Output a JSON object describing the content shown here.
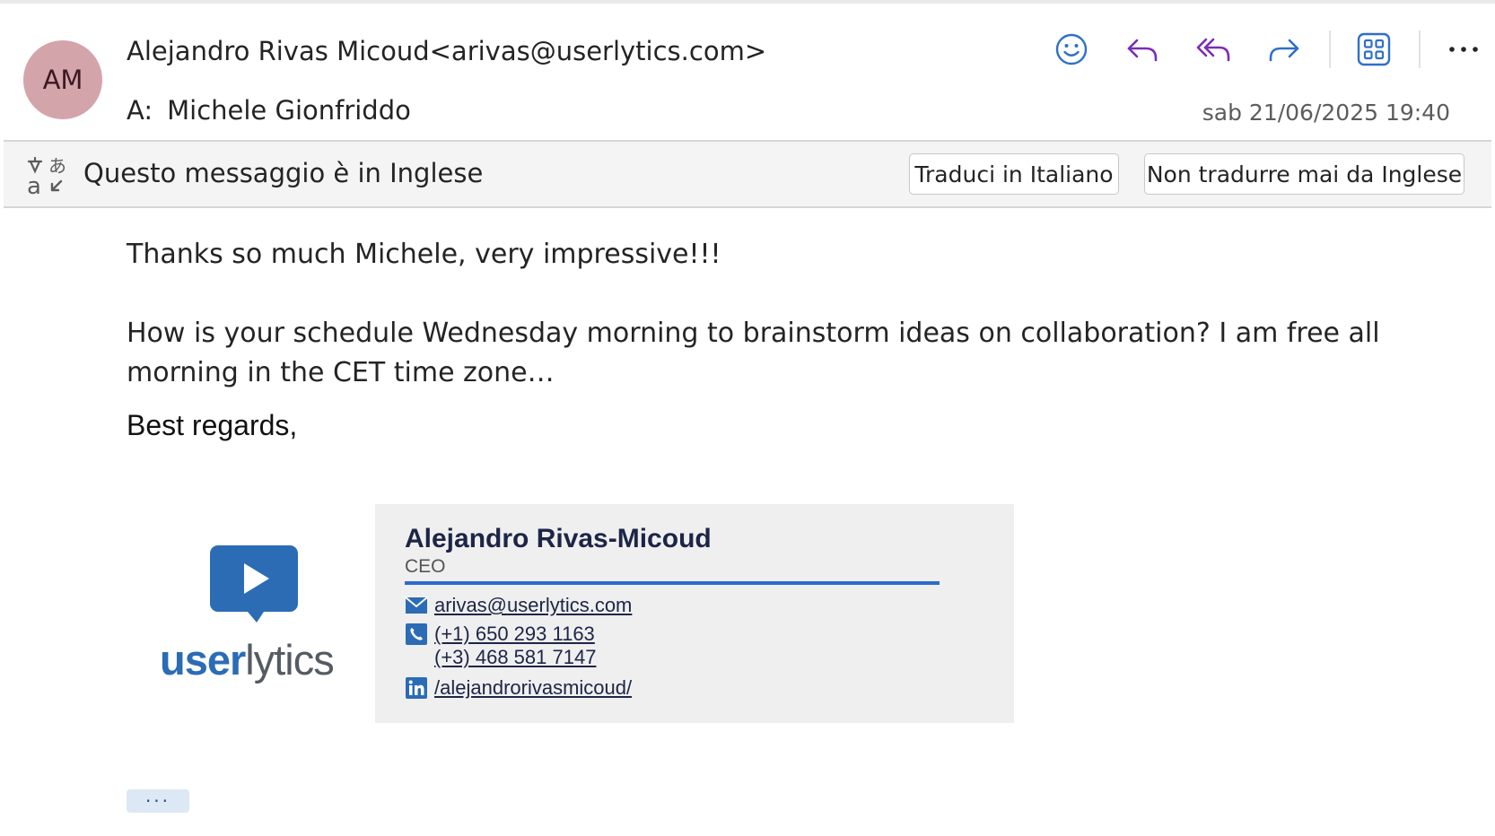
{
  "header": {
    "avatar_initials": "AM",
    "avatar_color": "#d4a4ab",
    "sender_line": "Alejandro Rivas Micoud<arivas@userlytics.com>",
    "to_label": "A:",
    "recipient": "Michele Gionfriddo",
    "datetime": "sab 21/06/2025 19:40",
    "actions": [
      {
        "name": "react",
        "icon": "smiley-icon"
      },
      {
        "name": "reply",
        "icon": "reply-icon"
      },
      {
        "name": "reply-all",
        "icon": "reply-all-icon"
      },
      {
        "name": "forward",
        "icon": "forward-icon"
      },
      {
        "name": "apps",
        "icon": "apps-grid-icon"
      },
      {
        "name": "more",
        "icon": "more-icon"
      }
    ],
    "accent_color": "#7c2bb8",
    "forward_color": "#2f6fc9"
  },
  "translation_bar": {
    "icon": "translate-icon",
    "message": "Questo messaggio è in Inglese",
    "translate_button": "Traduci in Italiano",
    "never_translate_button": "Non tradurre mai da Inglese"
  },
  "body": {
    "paragraph1": "Thanks so much Michele, very impressive!!!",
    "paragraph2": "How is your schedule Wednesday morning to brainstorm ideas on collaboration? I am free all morning in the CET time zone…",
    "closing": "Best regards,"
  },
  "signature": {
    "logo_text_bold": "user",
    "logo_text_light": "lytics",
    "logo_color": "#2b6cb5",
    "name": "Alejandro Rivas-Micoud",
    "title": "CEO",
    "email": "arivas@userlytics.com",
    "phone1": "(+1) 650 293 1163",
    "phone2": "(+3) 468 581 7147",
    "linkedin": "/alejandrorivasmicoud/"
  },
  "footer": {
    "more_label": "···"
  }
}
